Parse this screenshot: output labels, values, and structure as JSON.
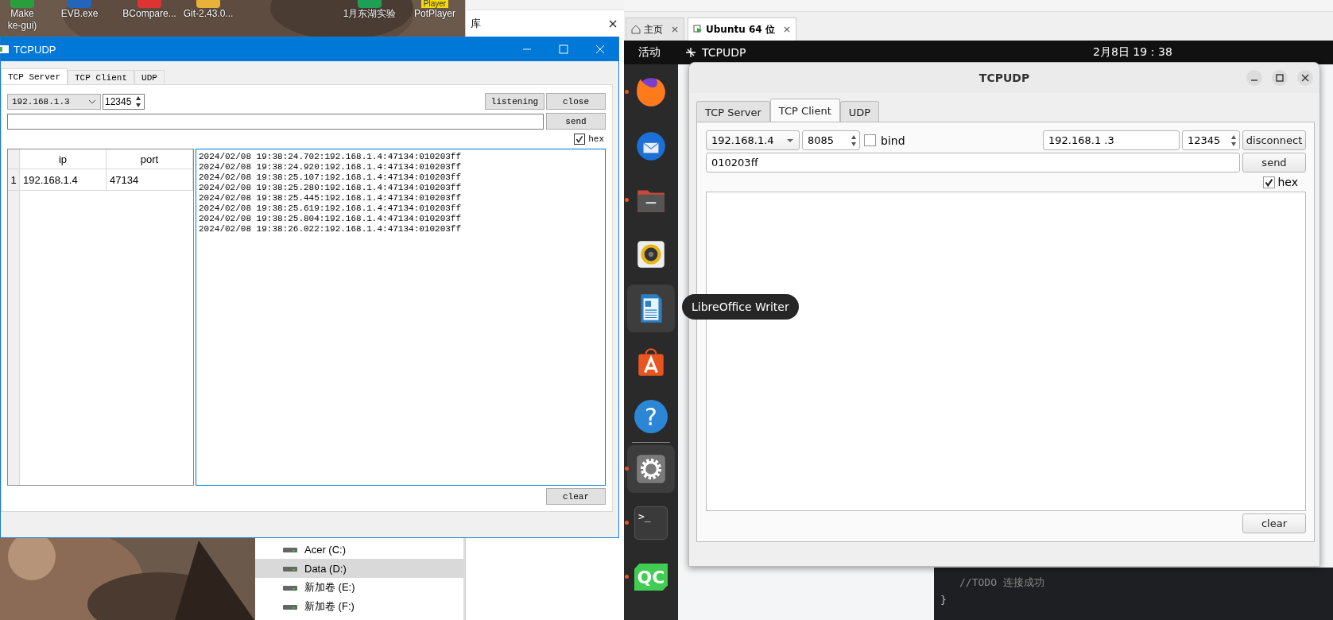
{
  "desktop": {
    "icons": [
      {
        "kind": "cmake",
        "lines": [
          "Make",
          "ke-gui)"
        ]
      },
      {
        "kind": "evb",
        "lines": [
          "EVB.exe"
        ]
      },
      {
        "kind": "shortcut",
        "lines": [
          "BCompare..."
        ]
      },
      {
        "kind": "git",
        "lines": [
          "Git-2.43.0..."
        ]
      },
      {
        "kind": "sheet",
        "lines": [
          "1月东湖实验"
        ]
      },
      {
        "kind": "player",
        "badge": "Player",
        "lines": [
          "PotPlayer"
        ]
      }
    ]
  },
  "library": {
    "title": "库"
  },
  "drives": [
    {
      "label": "Acer (C:)",
      "selected": false
    },
    {
      "label": "Data (D:)",
      "selected": true
    },
    {
      "label": "新加卷 (E:)",
      "selected": false
    },
    {
      "label": "新加卷 (F:)",
      "selected": false
    }
  ],
  "win_app": {
    "title": "TCPUDP",
    "tabs": [
      {
        "label": "TCP Server",
        "selected": true
      },
      {
        "label": "TCP Client",
        "selected": false
      },
      {
        "label": "UDP",
        "selected": false
      }
    ],
    "ip": "192.168.1.3",
    "port": "12345",
    "listen_button": "listening",
    "close_button": "close",
    "send_button": "send",
    "hex": {
      "label": "hex",
      "checked": true
    },
    "table": {
      "columns": [
        "ip",
        "port"
      ],
      "rows": [
        {
          "number": "1",
          "ip": "192.168.1.4",
          "port": "47134"
        }
      ]
    },
    "log": [
      "2024/02/08 19:38:24.702:192.168.1.4:47134:010203ff",
      "2024/02/08 19:38:24.920:192.168.1.4:47134:010203ff",
      "2024/02/08 19:38:25.107:192.168.1.4:47134:010203ff",
      "2024/02/08 19:38:25.280:192.168.1.4:47134:010203ff",
      "2024/02/08 19:38:25.445:192.168.1.4:47134:010203ff",
      "2024/02/08 19:38:25.619:192.168.1.4:47134:010203ff",
      "2024/02/08 19:38:25.804:192.168.1.4:47134:010203ff",
      "2024/02/08 19:38:26.022:192.168.1.4:47134:010203ff"
    ],
    "clear_button": "clear"
  },
  "vmware": {
    "tabs": [
      {
        "label": "主页",
        "selected": false
      },
      {
        "label": "Ubuntu 64 位",
        "selected": true
      }
    ]
  },
  "ubuntu": {
    "activities": "活动",
    "app_name": "TCPUDP",
    "clock": "2月8日  19：38",
    "dock": {
      "pinned": [
        {
          "kind": "firefox",
          "running": true,
          "hovered": false
        },
        {
          "kind": "thunderbird",
          "running": false,
          "hovered": false
        },
        {
          "kind": "files",
          "running": true,
          "hovered": false
        },
        {
          "kind": "rhythmbox",
          "running": false,
          "hovered": false
        },
        {
          "kind": "writer",
          "running": false,
          "hovered": true
        },
        {
          "kind": "appstore",
          "running": false,
          "hovered": false
        },
        {
          "kind": "help",
          "glyph": "?",
          "running": false,
          "hovered": false
        }
      ],
      "running_apps": [
        {
          "kind": "settings",
          "running": true,
          "hovered": true
        },
        {
          "kind": "terminal",
          "glyph": ">_",
          "running": true,
          "hovered": false
        },
        {
          "kind": "qt",
          "glyph": "QC",
          "running": true,
          "hovered": false
        }
      ]
    },
    "tooltip": "LibreOffice Writer",
    "window": {
      "title": "TCPUDP",
      "tabs": [
        {
          "label": "TCP Server",
          "selected": false
        },
        {
          "label": "TCP Client",
          "selected": true
        },
        {
          "label": "UDP",
          "selected": false
        }
      ],
      "local_ip": "192.168.1.4",
      "local_port": "8085",
      "bind": {
        "label": "bind",
        "checked": false
      },
      "server_ip": "192.168.1  .3",
      "server_port": "12345",
      "disconnect_button": "disconnect",
      "message": "010203ff",
      "send_button": "send",
      "hex": {
        "label": "hex",
        "checked": true
      },
      "clear_button": "clear"
    }
  },
  "editor": {
    "lines": [
      "//TODO 连接成功",
      "}"
    ]
  }
}
